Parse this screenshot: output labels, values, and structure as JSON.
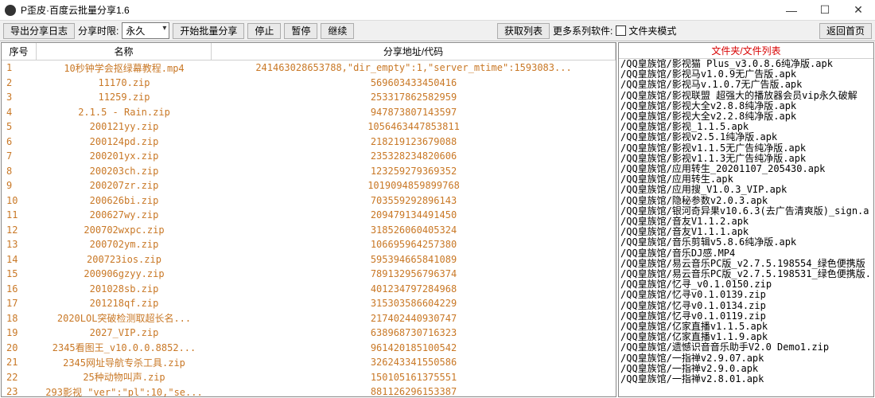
{
  "window": {
    "title": "P歪皮·百度云批量分享1.6"
  },
  "toolbar": {
    "export_log": "导出分享日志",
    "share_time_label": "分享时限:",
    "share_time_value": "永久",
    "start": "开始批量分享",
    "stop": "停止",
    "pause": "暂停",
    "resume": "继续",
    "get_list": "获取列表",
    "more_software": "更多系列软件:",
    "folder_mode": "文件夹模式",
    "back_home": "返回首页"
  },
  "grid": {
    "headers": {
      "idx": "序号",
      "name": "名称",
      "addr": "分享地址/代码"
    },
    "rows": [
      {
        "idx": "1",
        "name": "10秒钟学会抠绿幕教程.mp4",
        "addr": "241463028653788,\"dir_empty\":1,\"server_mtime\":1593083..."
      },
      {
        "idx": "2",
        "name": "11170.zip",
        "addr": "569603433450416"
      },
      {
        "idx": "3",
        "name": "11259.zip",
        "addr": "253317862582959"
      },
      {
        "idx": "4",
        "name": "2.1.5 - Rain.zip",
        "addr": "947873807143597"
      },
      {
        "idx": "5",
        "name": "200121yy.zip",
        "addr": "1056463447853811"
      },
      {
        "idx": "6",
        "name": "200124pd.zip",
        "addr": "218219123679088"
      },
      {
        "idx": "7",
        "name": "200201yx.zip",
        "addr": "235328234820606"
      },
      {
        "idx": "8",
        "name": "200203ch.zip",
        "addr": "123259279369352"
      },
      {
        "idx": "9",
        "name": "200207zr.zip",
        "addr": "1019094859899768"
      },
      {
        "idx": "10",
        "name": "200626bi.zip",
        "addr": "703559292896143"
      },
      {
        "idx": "11",
        "name": "200627wy.zip",
        "addr": "209479134491450"
      },
      {
        "idx": "12",
        "name": "200702wxpc.zip",
        "addr": "318526060405324"
      },
      {
        "idx": "13",
        "name": "200702ym.zip",
        "addr": "106695964257380"
      },
      {
        "idx": "14",
        "name": "200723ios.zip",
        "addr": "595394665841089"
      },
      {
        "idx": "15",
        "name": "200906gzyy.zip",
        "addr": "789132956796374"
      },
      {
        "idx": "16",
        "name": "201028sb.zip",
        "addr": "401234797284968"
      },
      {
        "idx": "17",
        "name": "201218qf.zip",
        "addr": "315303586604229"
      },
      {
        "idx": "18",
        "name": "2020LOL突破检测取超长名...",
        "addr": "217402440930747"
      },
      {
        "idx": "19",
        "name": "2027_VIP.zip",
        "addr": "638968730716323"
      },
      {
        "idx": "20",
        "name": "2345看图王_v10.0.0.8852...",
        "addr": "961420185100542"
      },
      {
        "idx": "21",
        "name": "2345网址导航专杀工具.zip",
        "addr": "326243341550586"
      },
      {
        "idx": "22",
        "name": "25种动物叫声.zip",
        "addr": "150105161375551"
      },
      {
        "idx": "23",
        "name": "293影视 \"ver\":\"pl\":10,\"se...",
        "addr": "881126296153387"
      }
    ]
  },
  "right": {
    "title": "文件夹/文件列表",
    "items": [
      "/QQ皇族馆/影视猫 Plus_v3.0.8.6纯净版.apk",
      "/QQ皇族馆/影视马v1.0.9无广告版.apk",
      "/QQ皇族馆/影视马v.1.0.7无广告版.apk",
      "/QQ皇族馆/影视联盟 超强大的播放器会员vip永久破解",
      "/QQ皇族馆/影视大全v2.8.8纯净版.apk",
      "/QQ皇族馆/影视大全v2.2.8纯净版.apk",
      "/QQ皇族馆/影视_1.1.5.apk",
      "/QQ皇族馆/影视v2.5.1纯净版.apk",
      "/QQ皇族馆/影视v1.1.5无广告纯净版.apk",
      "/QQ皇族馆/影视v1.1.3无广告纯净版.apk",
      "/QQ皇族馆/应用转生_20201107_205430.apk",
      "/QQ皇族馆/应用转生.apk",
      "/QQ皇族馆/应用搜_V1.0.3_VIP.apk",
      "/QQ皇族馆/隐秘参数v2.0.3.apk",
      "/QQ皇族馆/银河奇异果v10.6.3(去广告清爽版)_sign.a",
      "/QQ皇族馆/音友V1.1.2.apk",
      "/QQ皇族馆/音友V1.1.1.apk",
      "/QQ皇族馆/音乐剪辑v5.8.6纯净版.apk",
      "/QQ皇族馆/音乐DJ感.MP4",
      "/QQ皇族馆/易云音乐PC版_v2.7.5.198554_绿色便携版",
      "/QQ皇族馆/易云音乐PC版_v2.7.5.198531_绿色便携版.",
      "/QQ皇族馆/忆寻_v0.1.0150.zip",
      "/QQ皇族馆/忆寻v0.1.0139.zip",
      "/QQ皇族馆/忆寻v0.1.0134.zip",
      "/QQ皇族馆/忆寻v0.1.0119.zip",
      "/QQ皇族馆/亿家直播v1.1.5.apk",
      "/QQ皇族馆/亿家直播v1.1.9.apk",
      "/QQ皇族馆/遗憾识音音乐助手V2.0 Demo1.zip",
      "/QQ皇族馆/一指禅v2.9.07.apk",
      "/QQ皇族馆/一指禅v2.9.0.apk",
      "/QQ皇族馆/一指禅v2.8.01.apk"
    ]
  }
}
